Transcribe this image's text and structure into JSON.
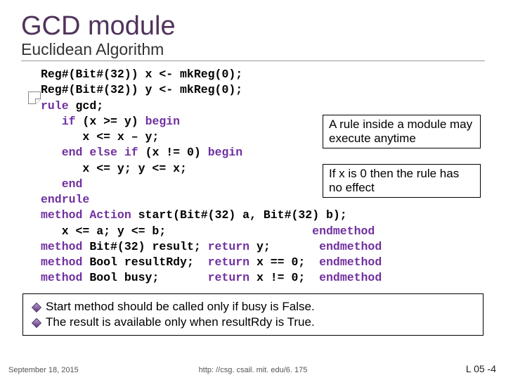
{
  "title": "GCD module",
  "subtitle": "Euclidean Algorithm",
  "code": {
    "l1a": "Reg#(Bit#(32)) x <- mkReg(0);",
    "l2a": "Reg#(Bit#(32)) y <- mkReg(0);",
    "kw_rule": "rule",
    "l3a": " gcd;",
    "kw_if": "if",
    "l4a": " (x >= y) ",
    "kw_begin1": "begin",
    "l5a": "      x <= x – y;",
    "kw_end1": "end",
    "kw_else": "else",
    "kw_if2": "if",
    "l6a": " (x != 0) ",
    "kw_begin2": "begin",
    "l7a": "      x <= y; y <= x;",
    "kw_end2": "end",
    "kw_endrule": "endrule",
    "kw_method1": "method",
    "kw_action": "Action",
    "l9a": " start(Bit#(32) a, Bit#(32) b);",
    "l10a": "   x <= a; y <= b;                     ",
    "kw_endm1": "endmethod",
    "kw_method2": "method",
    "l11a": " Bit#(32) result; ",
    "kw_return1": "return",
    "l11b": " y;       ",
    "kw_endm2": "endmethod",
    "kw_method3": "method",
    "l12a": " Bool resultRdy;  ",
    "kw_return2": "return",
    "l12b": " x == 0;  ",
    "kw_endm3": "endmethod",
    "kw_method4": "method",
    "l13a": " Bool busy;       ",
    "kw_return3": "return",
    "l13b": " x != 0;  ",
    "kw_endm4": "endmethod"
  },
  "callout1": "A rule inside a module may execute anytime",
  "callout2": "If x is 0 then the rule has no effect",
  "bullets": [
    "Start method should be called only if busy is False.",
    "The result is available only when resultRdy is True."
  ],
  "footer": {
    "date": "September 18, 2015",
    "url": "http: //csg. csail. mit. edu/6. 175",
    "num": "L 05 -4"
  }
}
